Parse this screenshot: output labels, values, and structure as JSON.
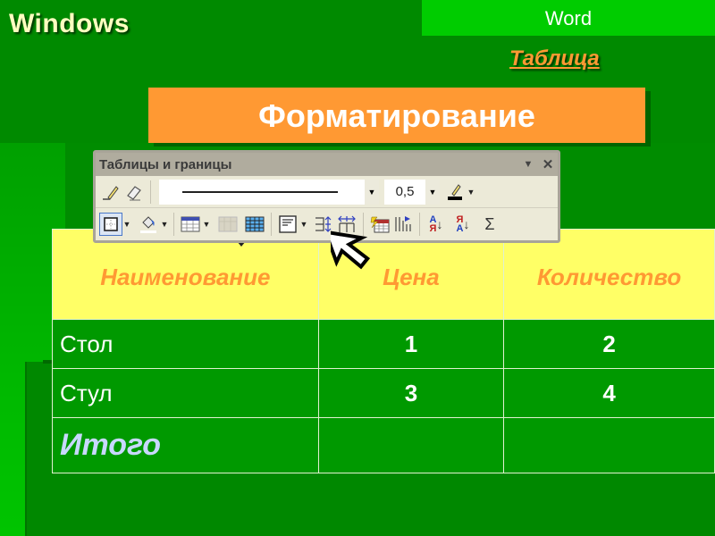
{
  "header": {
    "title": "Windows",
    "app_label": "Word",
    "section_label": "Таблица",
    "topic_banner": "Форматирование"
  },
  "toolbar": {
    "title": "Таблицы и границы",
    "line_weight": "0,5",
    "title_controls": {
      "menu": "▼",
      "close": "✕"
    },
    "row1_icons": [
      "pencil-icon",
      "eraser-icon",
      "line-style-select",
      "line-weight-select",
      "border-color-icon"
    ],
    "row2_icons": [
      "outside-border-icon",
      "shading-color-icon",
      "insert-table-icon",
      "merge-cells-icon",
      "split-cells-icon",
      "align-icon",
      "distribute-rows-icon",
      "distribute-columns-icon",
      "autoformat-icon",
      "text-direction-icon",
      "sort-ascending-icon",
      "sort-descending-icon",
      "autosum-icon"
    ],
    "sort_asc": {
      "top": "А",
      "bottom": "Я"
    },
    "sort_desc": {
      "top": "Я",
      "bottom": "А"
    },
    "sum_symbol": "Σ"
  },
  "table": {
    "headers": [
      "Наименование",
      "Цена",
      "Количество"
    ],
    "rows": [
      [
        "Стол",
        "1",
        "2"
      ],
      [
        "Стул",
        "3",
        "4"
      ]
    ],
    "total": [
      "Итого",
      "",
      ""
    ]
  },
  "colors": {
    "background": "#008800",
    "banner": "#ff9933",
    "header_row": "#ffff66",
    "word_box": "#00cc00",
    "title_text": "#ffffc0",
    "total_text": "#c8d8ff"
  }
}
